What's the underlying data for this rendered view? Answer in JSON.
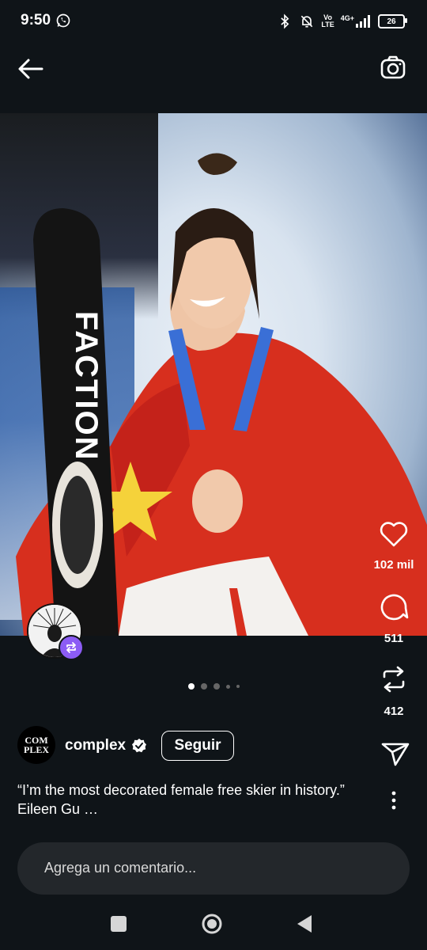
{
  "status_bar": {
    "time": "9:50",
    "network_top": "Vo",
    "network_bottom": "LTE",
    "signal_label": "4G+",
    "battery": "26"
  },
  "post": {
    "likes": "102 mil",
    "comments": "511",
    "reposts": "412",
    "pager_count": 5,
    "pager_active": 0
  },
  "author": {
    "logo_line1": "COM",
    "logo_line2": "PLEX",
    "name": "complex",
    "follow_label": "Seguir"
  },
  "caption": "“I’m the most decorated female free skier in history.” Eileen Gu …",
  "comment": {
    "placeholder": "Agrega un comentario..."
  },
  "colors": {
    "background": "#0f1418",
    "remix_badge": "#8c5cf5",
    "comment_box": "#23272b"
  }
}
